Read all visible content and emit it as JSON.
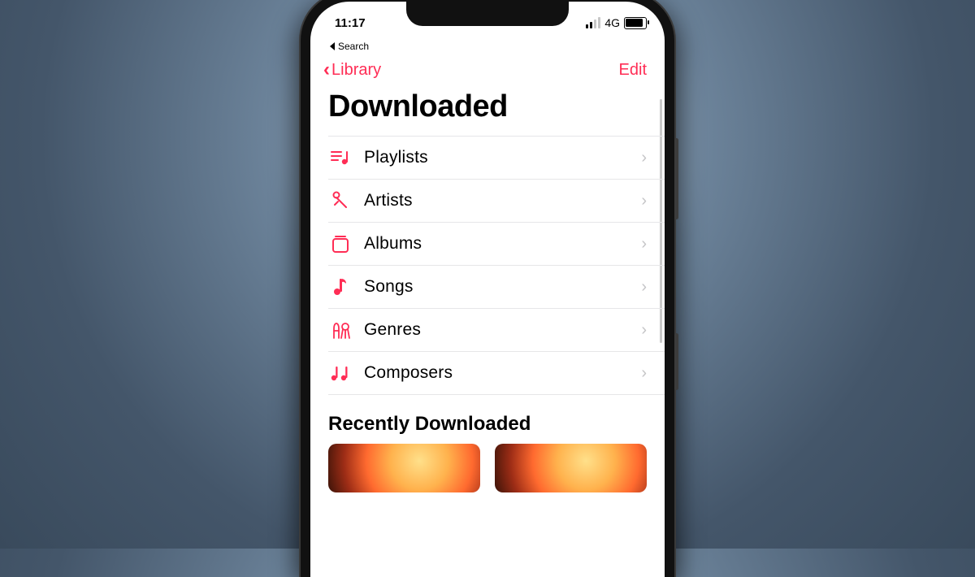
{
  "status": {
    "time": "11:17",
    "back_app": "Search",
    "network": "4G"
  },
  "nav": {
    "back_label": "Library",
    "edit_label": "Edit"
  },
  "page_title": "Downloaded",
  "sections": {
    "recent_header": "Recently Downloaded"
  },
  "list": [
    {
      "icon": "playlists-icon",
      "label": "Playlists"
    },
    {
      "icon": "artists-icon",
      "label": "Artists"
    },
    {
      "icon": "albums-icon",
      "label": "Albums"
    },
    {
      "icon": "songs-icon",
      "label": "Songs"
    },
    {
      "icon": "genres-icon",
      "label": "Genres"
    },
    {
      "icon": "composers-icon",
      "label": "Composers"
    }
  ],
  "colors": {
    "accent": "#ff2d55"
  }
}
